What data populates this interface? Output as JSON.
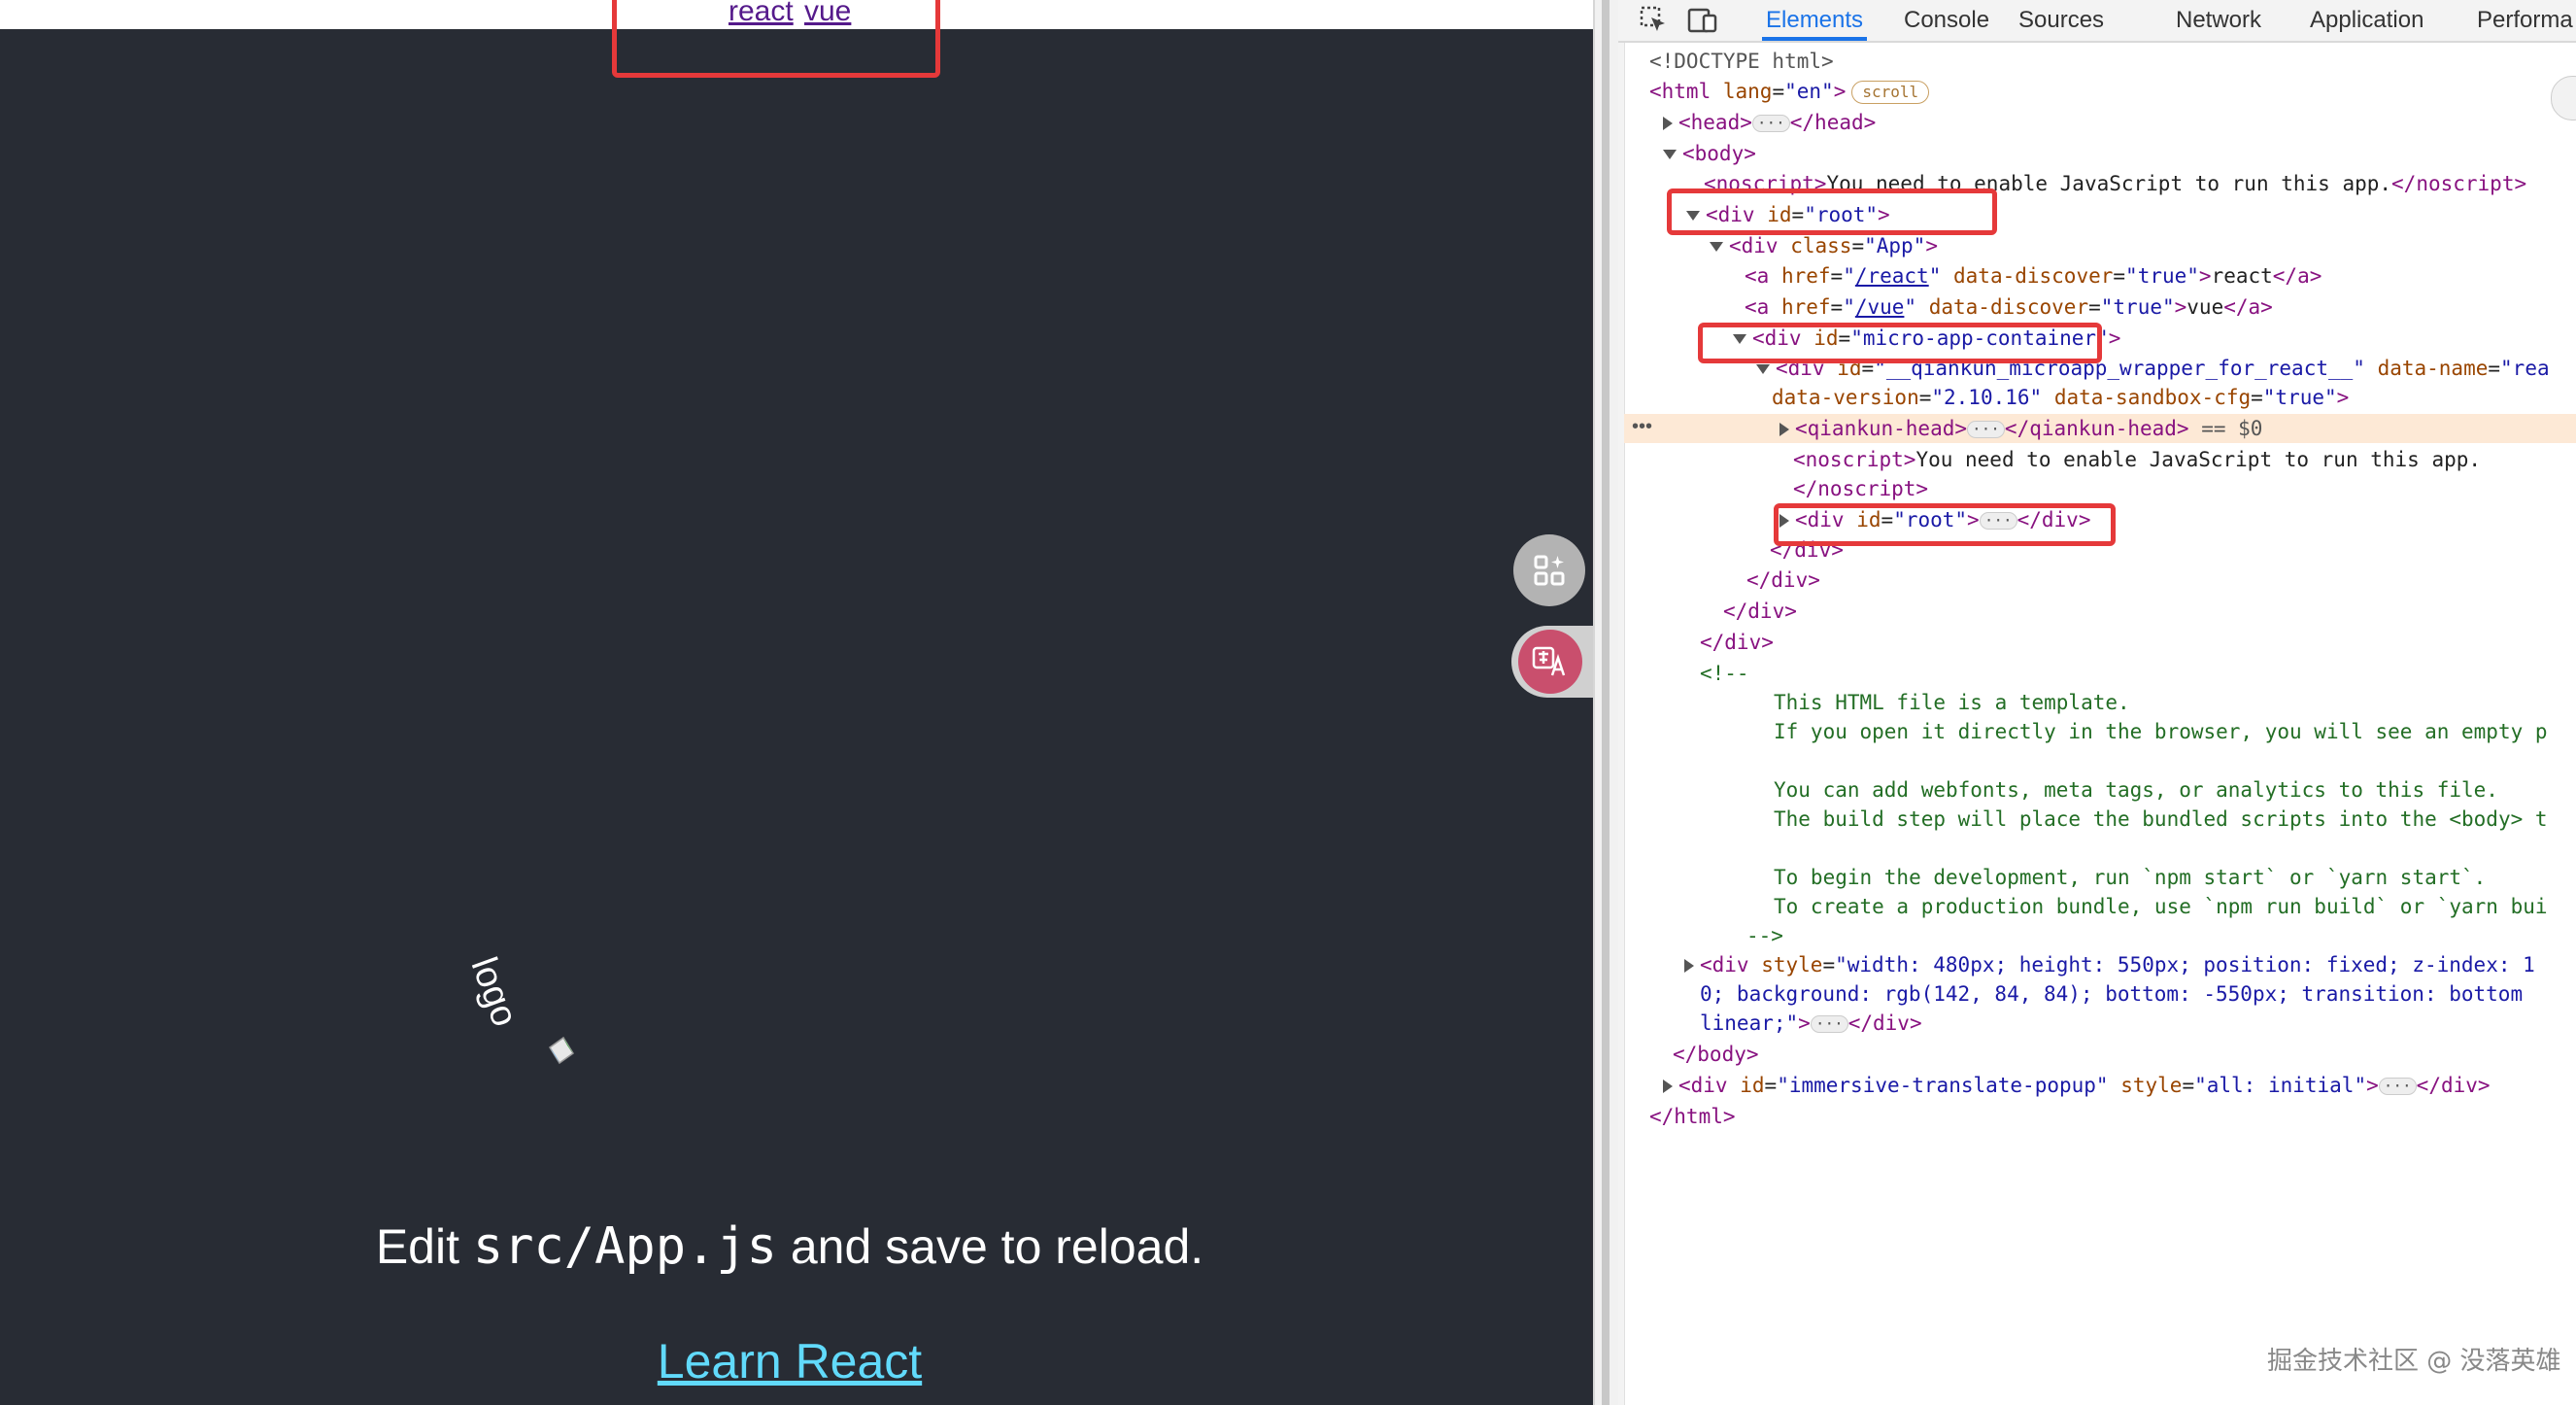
{
  "page": {
    "links": [
      {
        "label": "react"
      },
      {
        "label": "vue"
      }
    ],
    "logo_alt": "logo",
    "edit_prefix": "Edit ",
    "edit_code": "src/App.js",
    "edit_suffix": " and save to reload.",
    "learn_link": "Learn React",
    "floating_buttons": [
      {
        "icon": "apps-icon"
      },
      {
        "icon": "translate-icon"
      }
    ]
  },
  "devtools": {
    "tabs": [
      "Elements",
      "Console",
      "Sources",
      "Network",
      "Application",
      "Performa"
    ],
    "active_tab": "Elements",
    "scroll_badge": "scroll",
    "selected_suffix": " == $0",
    "noscript_text": "You need to enable JavaScript to run this app.",
    "comment_lines": [
      "This HTML file is a template.",
      "If you open it directly in the browser, you will see an empty p",
      "",
      "You can add webfonts, meta tags, or analytics to this file.",
      "The build step will place the bundled scripts into the <body> t",
      "",
      "To begin the development, run `npm start` or `yarn start`.",
      "To create a production bundle, use `npm run build` or `yarn bui"
    ],
    "style_attr_lines": [
      "width: 480px; height: 550px; position: fixed; z-index: 1",
      "0; background: rgb(142, 84, 84); bottom: -550px; transition: bottom",
      "linear;"
    ]
  },
  "watermark": "掘金技术社区 @ 没落英雄",
  "colors": {
    "page_bg": "#282c34",
    "link_visited": "#551a8b",
    "learn_link": "#61dafb",
    "highlight_box": "#e5393a",
    "active_tab": "#1a73e8",
    "selected_row": "#fde9d6"
  }
}
